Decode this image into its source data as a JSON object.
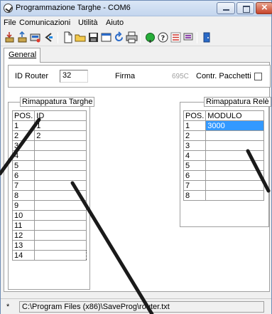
{
  "window": {
    "title": "Programmazione Targhe - COM6",
    "icon": "app-logo-icon",
    "controls": [
      "minimize-icon",
      "maximize-icon",
      "close-icon"
    ]
  },
  "menu": {
    "items": [
      "File",
      "Comunicazioni",
      "Utilità",
      "Aiuto"
    ]
  },
  "toolbar": {
    "icons": [
      "read-icon",
      "write-icon",
      "scanner-icon",
      "back-arrow-icon",
      "new-file-icon",
      "open-folder-icon",
      "save-icon",
      "window-icon",
      "refresh-icon",
      "print-icon",
      "connect-icon",
      "help-icon",
      "settings-icon",
      "tools-icon",
      "exit-icon"
    ]
  },
  "tabs": [
    {
      "label": "General",
      "active": true
    }
  ],
  "router": {
    "id_label": "ID Router",
    "id_value": "32",
    "firma_label": "Firma",
    "firma_value": "695C",
    "packets_label": "Contr. Pacchetti",
    "packets_checked": false
  },
  "targhe": {
    "title": "Rimappatura Targhe",
    "columns": [
      "POS.",
      "ID"
    ],
    "rows": [
      [
        "1",
        "1"
      ],
      [
        "2",
        "2"
      ],
      [
        "3",
        ""
      ],
      [
        "4",
        ""
      ],
      [
        "5",
        ""
      ],
      [
        "6",
        ""
      ],
      [
        "7",
        ""
      ],
      [
        "8",
        ""
      ],
      [
        "9",
        ""
      ],
      [
        "10",
        ""
      ],
      [
        "11",
        ""
      ],
      [
        "12",
        ""
      ],
      [
        "13",
        ""
      ],
      [
        "14",
        ""
      ]
    ]
  },
  "rele": {
    "title": "Rimappatura Relè",
    "columns": [
      "POS.",
      "MODULO"
    ],
    "rows": [
      [
        "1",
        "3000"
      ],
      [
        "2",
        ""
      ],
      [
        "3",
        ""
      ],
      [
        "4",
        ""
      ],
      [
        "5",
        ""
      ],
      [
        "6",
        ""
      ],
      [
        "7",
        ""
      ],
      [
        "8",
        ""
      ]
    ]
  },
  "status": {
    "mark": "*",
    "path": "C:\\Program Files (x86)\\SaveProg\\router.txt"
  },
  "colors": {
    "selection": "#3399ff",
    "title_bar": "#c3d5ee",
    "close_button": "#c7432a"
  }
}
